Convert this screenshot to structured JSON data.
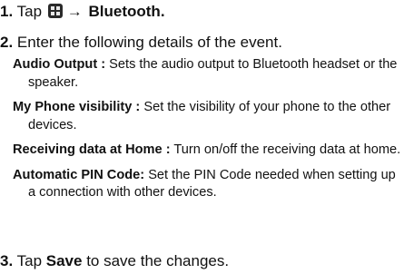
{
  "step1": {
    "number": "1.",
    "prefix": "Tap",
    "icon": "menu-grid-icon",
    "arrow": "→",
    "target": "Bluetooth."
  },
  "step2": {
    "number": "2.",
    "text": "Enter the following details of the event."
  },
  "details": [
    {
      "term": "Audio Output :",
      "desc": " Sets the audio output to Bluetooth headset or the speaker."
    },
    {
      "term": "My Phone visibility  :",
      "desc": " Set the visibility of your phone to the other devices."
    },
    {
      "term": "Receiving data at Home :",
      "desc": " Turn on/off the receiving data at home."
    },
    {
      "term": "Automatic PIN Code:",
      "desc": " Set the PIN Code needed when setting up a connection with other devices."
    }
  ],
  "step3": {
    "number": "3.",
    "prefix": "Tap",
    "target": "Save",
    "suffix": "to save the changes."
  }
}
